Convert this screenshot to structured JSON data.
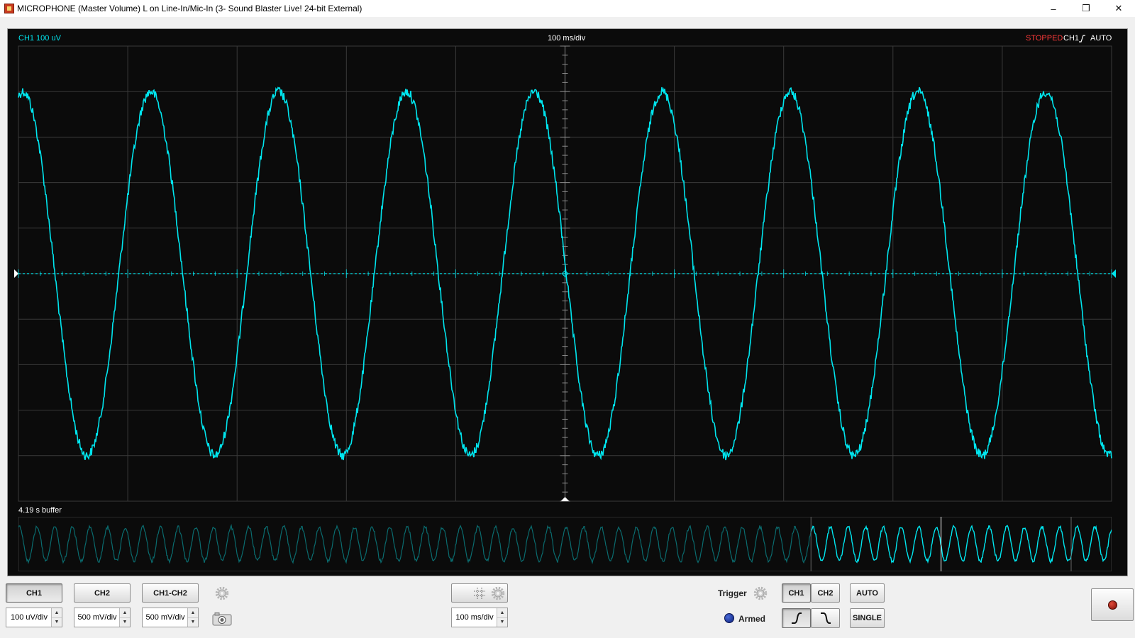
{
  "window": {
    "title": "MICROPHONE (Master Volume) L on Line-In/Mic-In (3- Sound Blaster Live! 24-bit External)",
    "minimize_glyph": "–",
    "restore_glyph": "❐",
    "close_glyph": "✕"
  },
  "scope": {
    "ch1_scale_label": "CH1 100 uV",
    "timebase_label": "100 ms/div",
    "status_label": "STOPPED",
    "trigger_channel_label": "CH1",
    "trigger_mode_label": "AUTO",
    "buffer_label": "4.19 s buffer",
    "colors": {
      "trace": "#00e5ee",
      "grid": "#3a3a3a",
      "status": "#ff3a3a",
      "background": "#0b0b0b"
    },
    "divisions": {
      "horizontal": 10,
      "vertical": 10
    },
    "signal": {
      "cycles_on_screen": 8.55,
      "amplitude_divisions": 4.0,
      "phase_cycles": 0.215
    },
    "buffer_window": {
      "start_fraction": 0.725,
      "end_fraction": 1.0,
      "cursor_fraction": 0.844
    }
  },
  "controls": {
    "ch1_button": "CH1",
    "ch2_button": "CH2",
    "ch1_ch2_button": "CH1-CH2",
    "ch1_scale": "100 uV/div",
    "ch2_scale": "500 mV/div",
    "diff_scale": "500 mV/div",
    "timebase": "100 ms/div",
    "trigger_label": "Trigger",
    "trigger_ch1": "CH1",
    "trigger_ch2": "CH2",
    "auto_button": "AUTO",
    "single_button": "SINGLE",
    "armed_label": "Armed"
  }
}
